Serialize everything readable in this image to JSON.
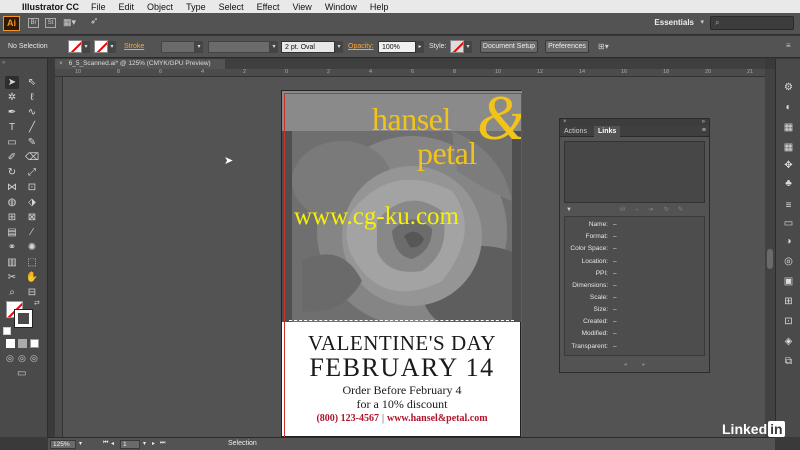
{
  "menubar": {
    "app_name": "Illustrator CC",
    "items": [
      "File",
      "Edit",
      "Object",
      "Type",
      "Select",
      "Effect",
      "View",
      "Window",
      "Help"
    ]
  },
  "appbar": {
    "logo": "Ai",
    "bridge": "Br",
    "stock": "St",
    "workspace": "Essentials"
  },
  "control_bar": {
    "selection_status": "No Selection",
    "stroke_label": "Stroke",
    "brush_profile": "2 pt. Oval",
    "opacity_label": "Opacity:",
    "opacity_value": "100%",
    "style_label": "Style:",
    "document_setup": "Document Setup",
    "preferences": "Preferences"
  },
  "document_tab": {
    "title": "6_5_Scanned.ai* @ 125% (CMYK/GPU Preview)"
  },
  "ruler": {
    "top_ticks": [
      "10",
      "8",
      "6",
      "4",
      "2",
      "0",
      "2",
      "4",
      "6",
      "8",
      "10",
      "12",
      "14",
      "16",
      "18",
      "20",
      "21"
    ]
  },
  "artboard": {
    "brand_line1": "hansel",
    "brand_amp": "&",
    "brand_line2": "petal",
    "watermark": "www.cg-ku.com",
    "title": "VALENTINE'S DAY",
    "date": "FEBRUARY 14",
    "order_line": "Order Before February 4",
    "discount_line": "for a 10% discount",
    "phone": "(800) 123-4567",
    "separator": "|",
    "website": "www.hansel&petal.com"
  },
  "links_panel": {
    "tabs": [
      "Actions",
      "Links"
    ],
    "active_tab": "Links",
    "fields": [
      {
        "label": "Name:",
        "value": "–"
      },
      {
        "label": "Format:",
        "value": "–"
      },
      {
        "label": "Color Space:",
        "value": "–"
      },
      {
        "label": "Location:",
        "value": "–"
      },
      {
        "label": "PPI:",
        "value": "–"
      },
      {
        "label": "Dimensions:",
        "value": "–"
      },
      {
        "label": "Scale:",
        "value": "–"
      },
      {
        "label": "Size:",
        "value": "–"
      },
      {
        "label": "Created:",
        "value": "–"
      },
      {
        "label": "Modified:",
        "value": "–"
      },
      {
        "label": "Transparent:",
        "value": "–"
      }
    ]
  },
  "statusbar": {
    "zoom": "125%",
    "artboard_number": "1",
    "tool_name": "Selection"
  },
  "branding": {
    "text": "Linked",
    "in": "in"
  },
  "colors": {
    "brand_yellow": "#f2c31b",
    "watermark_yellow": "#f7f200",
    "contact_red": "#b0142d",
    "accent_orange": "#f7931e"
  }
}
